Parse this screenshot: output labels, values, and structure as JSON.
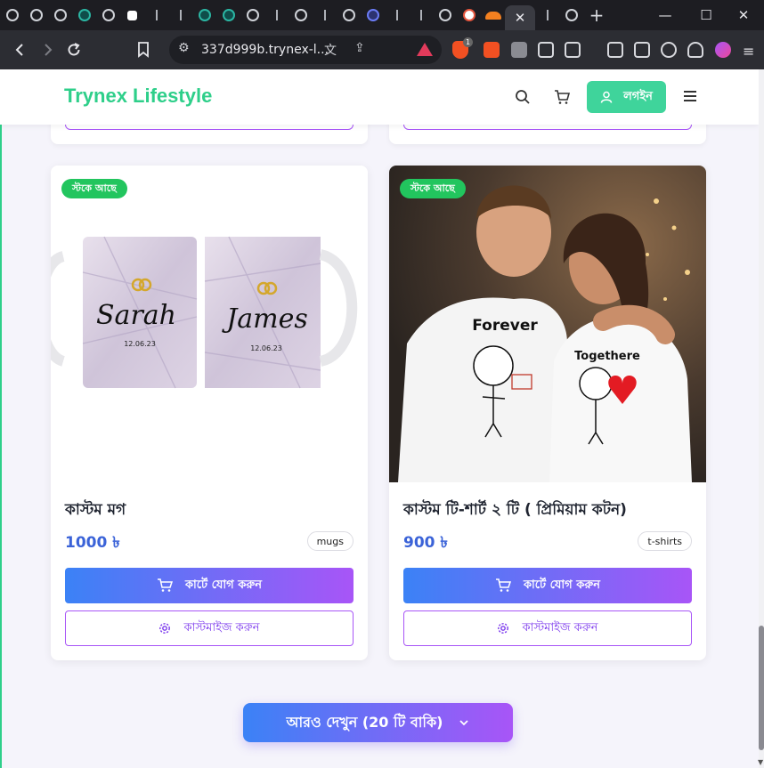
{
  "browser": {
    "url": "337d999b.trynex-l...",
    "active_tab_close": "✕",
    "new_tab": "+",
    "window_controls": {
      "minimize": "—",
      "maximize": "☐",
      "close": "✕"
    },
    "ext_badge_count": "1"
  },
  "site": {
    "brand": "Trynex Lifestyle",
    "login_label": "লগইন"
  },
  "products": [
    {
      "badge": "স্টকে আছে",
      "title": "কাস্টম মগ",
      "price": "1000 ৳",
      "category": "mugs",
      "add_to_cart": "কার্টে যোগ করুন",
      "customize": "কাস্টমাইজ করুন",
      "image_text": {
        "name1": "Sarah",
        "name2": "James",
        "date1": "12.06.23",
        "date2": "12.06.23"
      }
    },
    {
      "badge": "স্টকে আছে",
      "title": "কাস্টম টি-শার্ট ২ টি ( প্রিমিয়াম কটন)",
      "price": "900 ৳",
      "category": "t-shirts",
      "add_to_cart": "কার্টে যোগ করুন",
      "customize": "কাস্টমাইজ করুন",
      "image_text": {
        "shirt1": "Forever",
        "shirt2": "Togethere"
      }
    }
  ],
  "load_more": "আরও দেখুন (20 টি বাকি)",
  "colors": {
    "brand": "#2ecf8a",
    "accent_start": "#3b82f6",
    "accent_end": "#a855f7",
    "in_stock": "#22c55e",
    "price": "#3b63d8"
  }
}
